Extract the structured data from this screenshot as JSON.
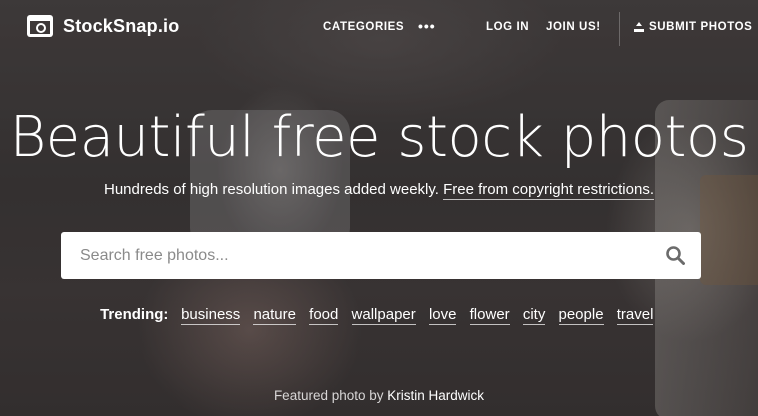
{
  "header": {
    "logo_text": "StockSnap.io",
    "nav": {
      "categories": "CATEGORIES",
      "more": "•••",
      "login": "LOG IN",
      "join": "JOIN US!",
      "submit": "SUBMIT PHOTOS"
    }
  },
  "hero": {
    "headline": "Beautiful free stock photos",
    "subline_text": "Hundreds of high resolution images added weekly.",
    "subline_link": "Free from copyright restrictions."
  },
  "search": {
    "placeholder": "Search free photos..."
  },
  "trending": {
    "label": "Trending:",
    "tags": [
      "business",
      "nature",
      "food",
      "wallpaper",
      "love",
      "flower",
      "city",
      "people",
      "travel"
    ]
  },
  "credit": {
    "prefix": "Featured photo by",
    "author": "Kristin Hardwick"
  }
}
